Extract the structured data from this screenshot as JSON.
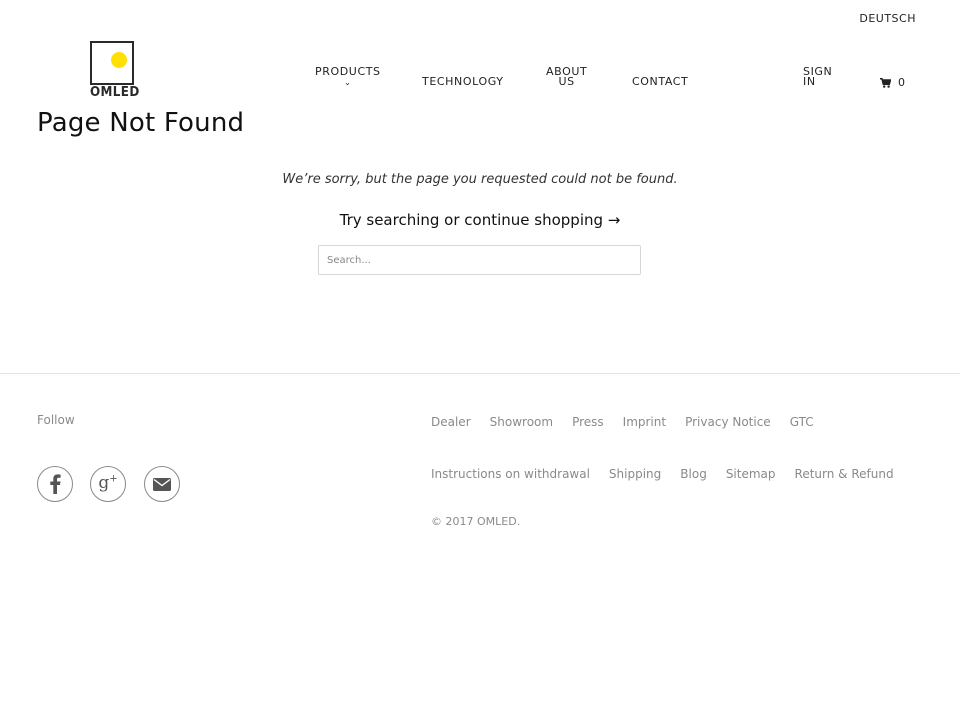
{
  "header": {
    "language": "DEUTSCH",
    "logo_text": "OMLED",
    "logo_accent": "#ffe000",
    "nav": {
      "products": "PRODUCTS",
      "products_chevron": "⌄",
      "technology": "TECHNOLOGY",
      "about_line1": "ABOUT",
      "about_line2": "US",
      "contact": "CONTACT",
      "signin_line1": "SIGN",
      "signin_line2": "IN"
    },
    "cart": {
      "icon": "cart-icon",
      "count": "0"
    }
  },
  "main": {
    "title": "Page Not Found",
    "message": "We’re sorry, but the page you requested could not be found.",
    "try_text": "Try searching or ",
    "continue_link": "continue shopping →",
    "search_placeholder": "Search..."
  },
  "footer": {
    "follow_label": "Follow",
    "social": [
      "facebook-icon",
      "google-plus-icon",
      "mail-icon"
    ],
    "links_row1": [
      "Dealer",
      "Showroom",
      "Press",
      "Imprint",
      "Privacy Notice",
      "GTC"
    ],
    "links_row2": [
      "Instructions on withdrawal",
      "Shipping",
      "Blog",
      "Sitemap",
      "Return & Refund"
    ],
    "copyright_prefix": "© 2017 ",
    "copyright_brand": "OMLED",
    "copyright_suffix": "."
  }
}
